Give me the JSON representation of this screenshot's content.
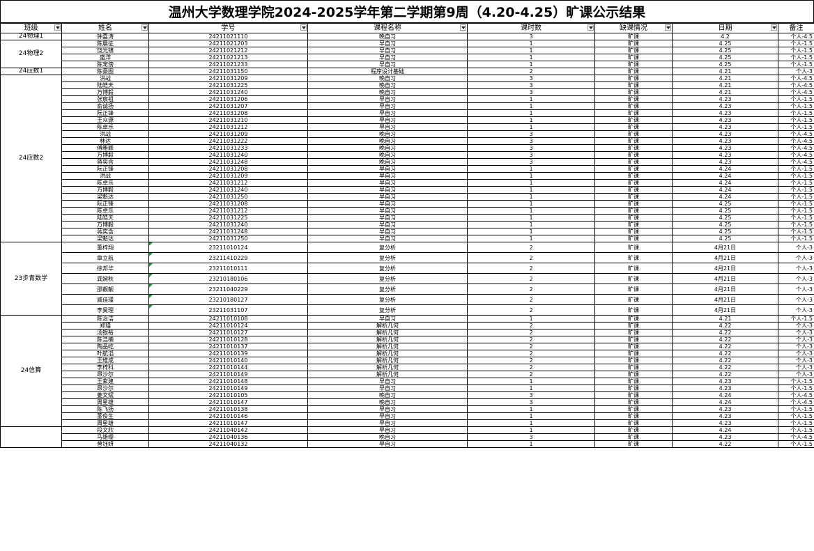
{
  "title": "温州大学数理学院2024-2025学年第二学期第9周（4.20-4.25）旷课公示结果",
  "headers": [
    "班级",
    "姓名",
    "学号",
    "课程名称",
    "课时数",
    "缺课情况",
    "日期",
    "备注"
  ],
  "groups": [
    {
      "name": "24物理1",
      "rows": [
        [
          "钟嘉涛",
          "24211021110",
          "晚自习",
          "3",
          "旷课",
          "4.2",
          "个人-4.5"
        ]
      ]
    },
    {
      "name": "24物理2",
      "rows": [
        [
          "陈晨征",
          "24211021203",
          "早自习",
          "1",
          "旷课",
          "4.25",
          "个人-1.5"
        ],
        [
          "饶光镇",
          "24211021212",
          "早自习",
          "1",
          "旷课",
          "4.25",
          "个人-1.5"
        ],
        [
          "盛洋",
          "24211021213",
          "早自习",
          "1",
          "旷课",
          "4.25",
          "个人-1.5"
        ],
        [
          "陈宠傍",
          "24211021233",
          "早自习",
          "1",
          "旷课",
          "4.25",
          "个人-1.5"
        ]
      ]
    },
    {
      "name": "24应数1",
      "rows": [
        [
          "陈豪图",
          "24211031150",
          "程序设计基础",
          "2",
          "旷课",
          "4.21",
          "个人-3"
        ]
      ]
    },
    {
      "name": "24应数2",
      "rows": [
        [
          "洪战",
          "24211031209",
          "晚自习",
          "3",
          "旷课",
          "4.21",
          "个人-4.5"
        ],
        [
          "陆皓天",
          "24211031225",
          "晚自习",
          "3",
          "旷课",
          "4.21",
          "个人-4.5"
        ],
        [
          "万博毅",
          "24211031240",
          "晚自习",
          "3",
          "旷课",
          "4.21",
          "个人-4.5"
        ],
        [
          "张宸祖",
          "24211031206",
          "早自习",
          "1",
          "旷课",
          "4.23",
          "个人-1.5"
        ],
        [
          "俞诚扬",
          "24211031207",
          "早自习",
          "1",
          "旷课",
          "4.23",
          "个人-1.5"
        ],
        [
          "阮正锋",
          "24211031208",
          "早自习",
          "1",
          "旷课",
          "4.23",
          "个人-1.5"
        ],
        [
          "王众源",
          "24211031210",
          "早自习",
          "1",
          "旷课",
          "4.23",
          "个人-1.5"
        ],
        [
          "陈卓乐",
          "24211031212",
          "早自习",
          "1",
          "旷课",
          "4.23",
          "个人-1.5"
        ],
        [
          "洪战",
          "24211031209",
          "晚自习",
          "3",
          "旷课",
          "4.23",
          "个人-4.5"
        ],
        [
          "林达",
          "24211031222",
          "晚自习",
          "3",
          "旷课",
          "4.23",
          "个人-4.5"
        ],
        [
          "傅雅颖",
          "24211031233",
          "晚自习",
          "3",
          "旷课",
          "4.23",
          "个人-4.5"
        ],
        [
          "万博毅",
          "24211031240",
          "晚自习",
          "3",
          "旷课",
          "4.23",
          "个人-4.5"
        ],
        [
          "蒋奕含",
          "24211031248",
          "晚自习",
          "3",
          "旷课",
          "4.23",
          "个人-4.5"
        ],
        [
          "阮正锋",
          "24211031208",
          "早自习",
          "1",
          "旷课",
          "4.24",
          "个人-1.5"
        ],
        [
          "洪战",
          "24211031209",
          "早自习",
          "1",
          "旷课",
          "4.24",
          "个人-1.5"
        ],
        [
          "陈卓乐",
          "24211031212",
          "早自习",
          "1",
          "旷课",
          "4.24",
          "个人-1.5"
        ],
        [
          "万博毅",
          "24211031240",
          "早自习",
          "1",
          "旷课",
          "4.24",
          "个人-1.5"
        ],
        [
          "梁魁达",
          "24211031250",
          "早自习",
          "1",
          "旷课",
          "4.24",
          "个人-1.5"
        ],
        [
          "阮正锋",
          "24211031208",
          "早自习",
          "1",
          "旷课",
          "4.25",
          "个人-1.5"
        ],
        [
          "陈卓乐",
          "24211031212",
          "早自习",
          "1",
          "旷课",
          "4.25",
          "个人-1.5"
        ],
        [
          "陆皓天",
          "24211031225",
          "早自习",
          "1",
          "旷课",
          "4.25",
          "个人-1.5"
        ],
        [
          "万博毅",
          "24211031240",
          "早自习",
          "1",
          "旷课",
          "4.25",
          "个人-1.5"
        ],
        [
          "蒋奕含",
          "24211031248",
          "早自习",
          "1",
          "旷课",
          "4.25",
          "个人-1.5"
        ],
        [
          "梁魁达",
          "24211031250",
          "早自习",
          "1",
          "旷课",
          "4.25",
          "个人-1.5"
        ]
      ]
    },
    {
      "name": "23步青数学",
      "tall": true,
      "marked": true,
      "rows": [
        [
          "董梓翔",
          "23211010124",
          "复分析",
          "2",
          "旷课",
          "4月21日",
          "个人-3"
        ],
        [
          "章立航",
          "23211410229",
          "复分析",
          "2",
          "旷课",
          "4月21日",
          "个人-3"
        ],
        [
          "徐邦华",
          "23211010111",
          "复分析",
          "2",
          "旷课",
          "4月21日",
          "个人-3"
        ],
        [
          "龚婉秋",
          "23210180106",
          "复分析",
          "2",
          "旷课",
          "4月21日",
          "个人-3"
        ],
        [
          "邵靓靓",
          "23211040229",
          "复分析",
          "2",
          "旷课",
          "4月21日",
          "个人-3"
        ],
        [
          "威佳瑾",
          "23210180127",
          "复分析",
          "2",
          "旷课",
          "4月21日",
          "个人-3"
        ],
        [
          "李昊理",
          "23211031107",
          "复分析",
          "2",
          "旷课",
          "4月21日",
          "个人-3"
        ]
      ]
    },
    {
      "name": "24信算",
      "rows": [
        [
          "陈治洁",
          "24211010108",
          "早自习",
          "1",
          "旷课",
          "4.21",
          "个人-1.5"
        ],
        [
          "郑瑾",
          "24211010124",
          "解析几何",
          "2",
          "旷课",
          "4.22",
          "个人-3"
        ],
        [
          "汤银裕",
          "24211010127",
          "解析几何",
          "2",
          "旷课",
          "4.22",
          "个人-3"
        ],
        [
          "陈浩楠",
          "24211010128",
          "解析几何",
          "2",
          "旷课",
          "4.22",
          "个人-3"
        ],
        [
          "陶品屹",
          "24211010137",
          "解析几何",
          "2",
          "旷课",
          "4.22",
          "个人-3"
        ],
        [
          "叶航滔",
          "24211010139",
          "解析几何",
          "2",
          "旷课",
          "4.22",
          "个人-3"
        ],
        [
          "王维成",
          "24211010140",
          "解析几何",
          "2",
          "旷课",
          "4.22",
          "个人-3"
        ],
        [
          "李梓科",
          "24211010144",
          "解析几何",
          "2",
          "旷课",
          "4.22",
          "个人-3"
        ],
        [
          "昂沙尔",
          "24211010149",
          "解析几何",
          "2",
          "旷课",
          "4.22",
          "个人-3"
        ],
        [
          "王紫建",
          "24211010148",
          "早自习",
          "1",
          "旷课",
          "4.23",
          "个人-1.5"
        ],
        [
          "昂沙尔",
          "24211010149",
          "早自习",
          "1",
          "旷课",
          "4.23",
          "个人-1.5"
        ],
        [
          "姜文斌",
          "24211010105",
          "晚自习",
          "3",
          "旷课",
          "4.24",
          "个人-4.5"
        ],
        [
          "周星雄",
          "24211010147",
          "晚自习",
          "3",
          "旷课",
          "4.24",
          "个人-4.5"
        ],
        [
          "陈飞扬",
          "24211010138",
          "早自习",
          "1",
          "旷课",
          "4.23",
          "个人-1.5"
        ],
        [
          "董俊生",
          "24211010146",
          "早自习",
          "1",
          "旷课",
          "4.23",
          "个人-1.5"
        ],
        [
          "周星雄",
          "24211010147",
          "早自习",
          "1",
          "旷课",
          "4.23",
          "个人-1.5"
        ]
      ]
    },
    {
      "name": "",
      "rows": [
        [
          "段文欣",
          "24211040142",
          "早自习",
          "1",
          "旷课",
          "4.24",
          "个人-1.5"
        ],
        [
          "马雄缨",
          "24211040136",
          "晚自习",
          "3",
          "旷课",
          "4.23",
          "个人-4.5"
        ],
        [
          "曾钰妍",
          "24211040132",
          "早自习",
          "1",
          "旷课",
          "4.22",
          "个人-1.5"
        ]
      ]
    }
  ]
}
